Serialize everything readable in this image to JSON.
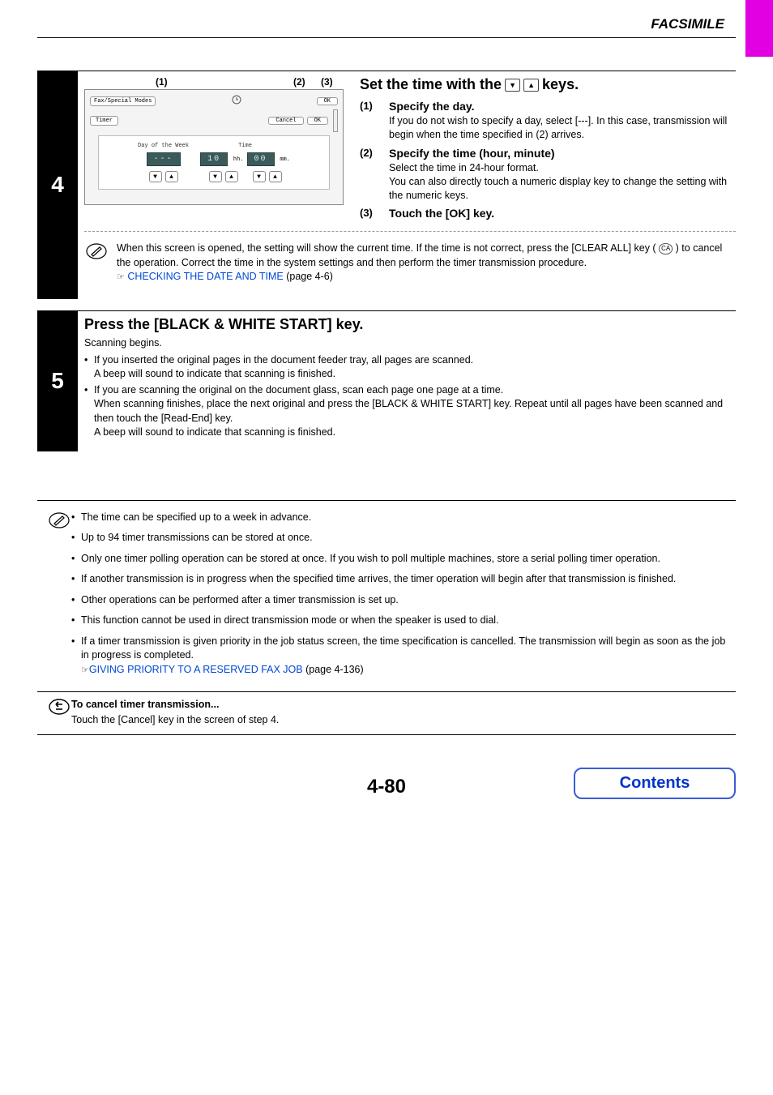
{
  "header": {
    "title": "FACSIMILE"
  },
  "step4": {
    "number": "4",
    "annotations": {
      "a1": "(1)",
      "a2": "(2)",
      "a3": "(3)"
    },
    "device": {
      "tab": "Fax/Special Modes",
      "ok_top": "OK",
      "timer_label": "Timer",
      "cancel": "Cancel",
      "ok_second": "OK",
      "col_day": "Day of the Week",
      "col_time": "Time",
      "val_day": "---",
      "val_hh": "10",
      "val_mm": "00",
      "unit_hh": "hh.",
      "unit_mm": "mm."
    },
    "heading_pre": "Set the time with the ",
    "heading_post": " keys.",
    "items": [
      {
        "num": "(1)",
        "title": "Specify the day.",
        "text": "If you do not wish to specify a day, select [---]. In this case, transmission will begin when the time specified in (2) arrives."
      },
      {
        "num": "(2)",
        "title": "Specify the time (hour, minute)",
        "text": "Select the time in 24-hour format.\nYou can also directly touch a numeric display key to change the setting with the numeric keys."
      },
      {
        "num": "(3)",
        "title": "Touch the [OK] key.",
        "text": ""
      }
    ],
    "note_pre": "When this screen is opened, the setting will show the current time. If the time is not correct, press the [CLEAR ALL] key (",
    "note_ca": "CA",
    "note_post": ") to cancel the operation. Correct the time in the system settings and then perform the timer transmission procedure.",
    "ref_icon": "☞",
    "ref_link": "CHECKING THE DATE AND TIME",
    "ref_page": " (page 4-6)"
  },
  "step5": {
    "number": "5",
    "title": "Press the [BLACK & WHITE START] key.",
    "lead": "Scanning begins.",
    "b1": "If you inserted the original pages in the document feeder tray, all pages are scanned.",
    "b1s": "A beep will sound to indicate that scanning is finished.",
    "b2": "If you are scanning the original on the document glass, scan each page one page at a time.",
    "b2s1": "When scanning finishes, place the next original and press the [BLACK & WHITE START] key. Repeat until all pages have been scanned and then touch the [Read-End] key.",
    "b2s2": "A beep will sound to indicate that scanning is finished."
  },
  "notes": {
    "items": [
      "The time can be specified up to a week in advance.",
      "Up to 94 timer transmissions can be stored at once.",
      "Only one timer polling operation can be stored at once. If you wish to poll multiple machines, store a serial polling timer operation.",
      "If another transmission is in progress when the specified time arrives, the timer operation will begin after that transmission is finished.",
      "Other operations can be performed after a timer transmission is set up.",
      "This function cannot be used in direct transmission mode or when the speaker is used to dial."
    ],
    "last_text": "If a timer transmission is given priority in the job status screen, the time specification is cancelled. The transmission will begin as soon as the job in progress is completed.",
    "ref_icon": "☞",
    "ref_link": "GIVING PRIORITY TO A RESERVED FAX JOB",
    "ref_page": " (page 4-136)",
    "cancel_title": "To cancel timer transmission...",
    "cancel_text": "Touch the [Cancel] key in the screen of step 4."
  },
  "footer": {
    "page": "4-80",
    "contents": "Contents"
  }
}
